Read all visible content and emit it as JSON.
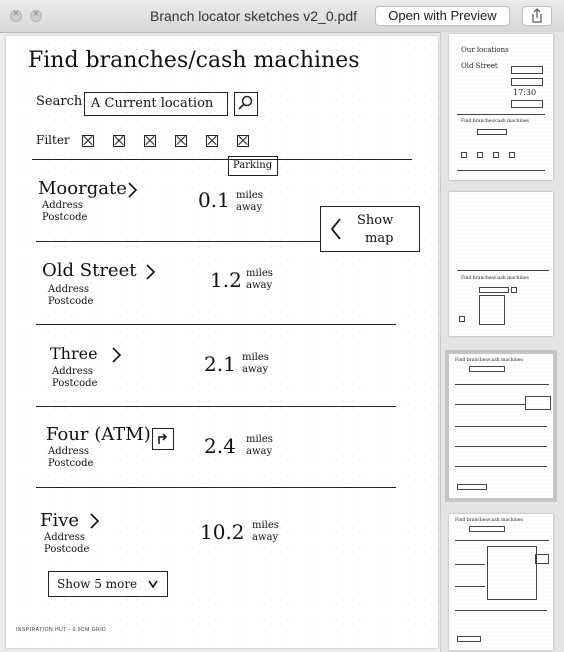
{
  "window": {
    "title": "Branch locator sketches v2_0.pdf",
    "open_button": "Open with Preview"
  },
  "sketch": {
    "heading": "Find branches/cash machines",
    "search_label": "Search",
    "search_value": "A Current location",
    "filter_label": "Filter",
    "filter_tooltip": "Parking",
    "show_map_line1": "Show",
    "show_map_line2": "map",
    "address": "Address",
    "postcode": "Postcode",
    "miles": "miles",
    "away": "away",
    "branches": [
      {
        "name": "Moorgate",
        "distance": "0.1"
      },
      {
        "name": "Old Street",
        "distance": "1.2"
      },
      {
        "name": "Three",
        "distance": "2.1"
      },
      {
        "name": "Four (ATM)",
        "distance": "2.4"
      },
      {
        "name": "Five",
        "distance": "10.2"
      }
    ],
    "show_more": "Show 5 more",
    "footer": "INSPIRATION HUT - 0.5CM GRID"
  },
  "thumbnails": {
    "t1_title": "Our locations",
    "t1_branch": "Old Street",
    "t1_time": "17:30",
    "t2_title": "Find branches/cash machines",
    "t3_title": "Find branches/cash machines",
    "t4_title": "Find branches/cash machines"
  }
}
